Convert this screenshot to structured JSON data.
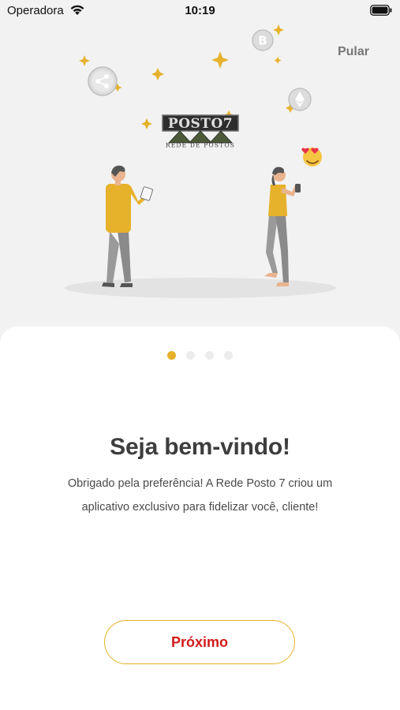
{
  "status_bar": {
    "carrier": "Operadora",
    "time": "10:19"
  },
  "onboarding": {
    "skip_label": "Pular",
    "logo": {
      "brand": "POSTO7",
      "tagline": "REDE DE POSTOS"
    },
    "pages_total": 4,
    "current_page": 1,
    "title": "Seja bem-vindo!",
    "description_line1": "Obrigado pela preferência! A Rede Posto 7 criou um",
    "description_line2": "aplicativo exclusivo para fidelizar você, cliente!",
    "next_label": "Próximo"
  },
  "colors": {
    "accent": "#e6b12b",
    "button_text": "#d01a1a",
    "title": "#3d3d3d",
    "background": "#f2f2f2"
  }
}
